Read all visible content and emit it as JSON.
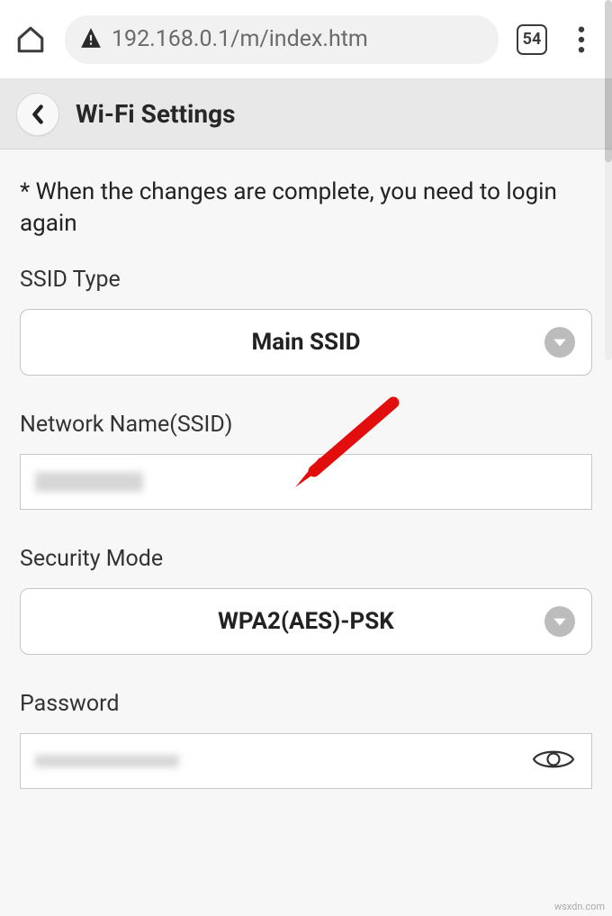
{
  "browser": {
    "url": "192.168.0.1/m/index.htm",
    "tab_count": "54"
  },
  "header": {
    "title": "Wi-Fi Settings"
  },
  "content": {
    "notice": "* When the changes are complete, you need to login again",
    "ssid_type_label": "SSID Type",
    "ssid_type_value": "Main SSID",
    "network_name_label": "Network Name(SSID)",
    "network_name_value": "",
    "security_mode_label": "Security Mode",
    "security_mode_value": "WPA2(AES)-PSK",
    "password_label": "Password",
    "password_value": ""
  },
  "watermark": "wsxdn.com"
}
